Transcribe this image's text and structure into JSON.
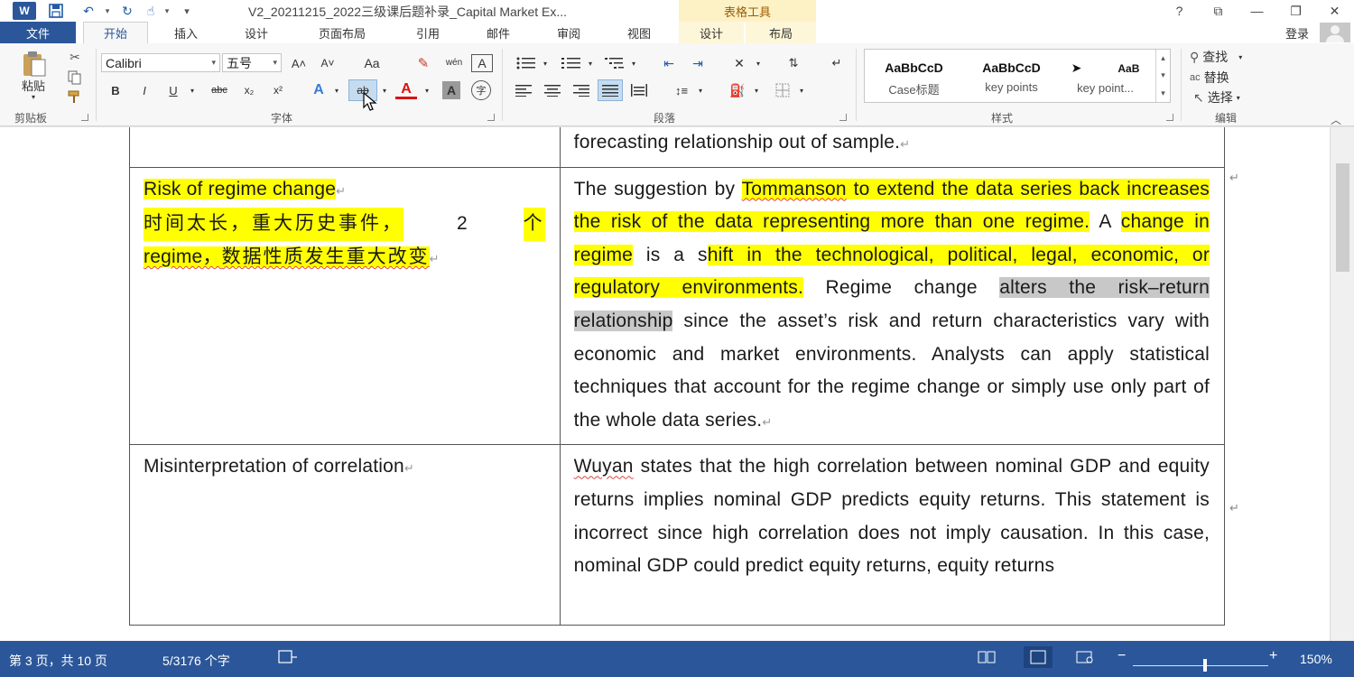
{
  "window": {
    "title": "V2_20211215_2022三级课后题补录_Capital Market Ex...",
    "context_tool": "表格工具",
    "help": "?",
    "restore_ribbon": "⧉",
    "minimize": "—",
    "maximize": "❐",
    "close": "✕"
  },
  "qat": {
    "save_icon": "save-icon",
    "undo": "↶",
    "redo": "↻",
    "touch": "☝",
    "customize": "▾"
  },
  "tabs": {
    "file": "文件",
    "items": [
      "开始",
      "插入",
      "设计",
      "页面布局",
      "引用",
      "邮件",
      "审阅",
      "视图"
    ],
    "context_items": [
      "设计",
      "布局"
    ],
    "login": "登录"
  },
  "ribbon": {
    "clipboard": {
      "paste": "粘贴",
      "label": "剪贴板"
    },
    "font": {
      "name": "Calibri",
      "size": "五号",
      "grow": "A˄",
      "shrink": "A˅",
      "case": "Aa",
      "clear": "✎",
      "phonetic": "wén",
      "border": "A",
      "bold": "B",
      "italic": "I",
      "underline": "U",
      "strike": "abc",
      "sub": "x₂",
      "sup": "x²",
      "effects": "A",
      "highlight": "ab",
      "color": "A",
      "shade": "A",
      "enclose": "字",
      "label": "字体"
    },
    "paragraph": {
      "label": "段落"
    },
    "styles": {
      "items": [
        {
          "sample": "AaBbCcD",
          "name": "Case标题"
        },
        {
          "sample": "AaBbCcD",
          "name": "key points"
        },
        {
          "sample": "➤",
          "sample2": "AaB",
          "name": "key point..."
        }
      ],
      "label": "样式"
    },
    "editing": {
      "find": "查找",
      "replace": "替换",
      "select": "选择",
      "label": "编辑"
    }
  },
  "document": {
    "top_row_text": "forecasting relationship out of sample.",
    "row1_left": {
      "title": "Risk of regime change",
      "cn_line1": "时间太长，重大历史事件，",
      "cn_line1_num": "2",
      "cn_line1_end": "个",
      "cn_line2a": "regime，",
      "cn_line2b": "数据性质发生重大改变"
    },
    "row1_right": {
      "p1": "The suggestion by ",
      "p2": "Tommanson",
      "p3": " to extend the data series back increases the risk of the data representing more than one regime.",
      "p4": " A ",
      "p5": "change in regime",
      "p6": " is a s",
      "p7": "hift in the technological, political, legal, economic, or regulatory environments.",
      "p8": " Regime change ",
      "p9": "alters the risk–return relationship",
      "p10": " since the asset’s risk and return characteristics vary with economic and market environments. Analysts can apply statistical techniques that account for the regime change or simply use only part of the whole data series."
    },
    "row2_left": "Misinterpretation of correlation",
    "row2_right": {
      "p1": "Wuyan",
      "p2": " states that the high correlation between nominal GDP and equity returns implies nominal GDP predicts equity returns. This statement is incorrect since high correlation does not imply causation. In this case, nominal GDP could predict equity returns, equity returns"
    },
    "para_mark": "↵"
  },
  "status": {
    "page": "第 3 页，共 10 页",
    "words": "5/3176 个字",
    "zoom": "150%",
    "zoom_minus": "−",
    "zoom_plus": "+"
  }
}
